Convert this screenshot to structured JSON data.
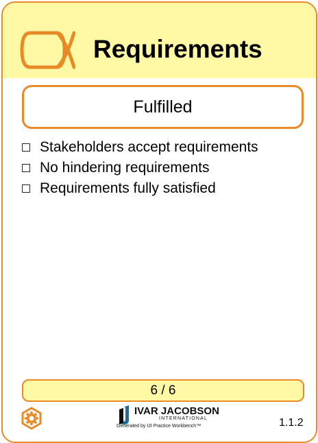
{
  "card": {
    "title": "Requirements",
    "alpha_icon": "alpha-state-icon",
    "state": "Fulfilled",
    "checklist": [
      {
        "label": "Stakeholders accept requirements",
        "checked": false
      },
      {
        "label": "No hindering requirements",
        "checked": false
      },
      {
        "label": "Requirements fully satisfied",
        "checked": false
      }
    ],
    "progress": "6 / 6",
    "footer_icon": "gear-icon",
    "logo": {
      "name": "IVAR JACOBSON",
      "sub": "INTERNATIONAL",
      "generated": "Generated by IJI Practice Workbench™"
    },
    "version": "1.1.2"
  },
  "colors": {
    "accent": "#e88a26",
    "header_bg": "#fff9a6",
    "progress_bg": "#fff9a6",
    "logo_blue": "#1b6f95"
  }
}
